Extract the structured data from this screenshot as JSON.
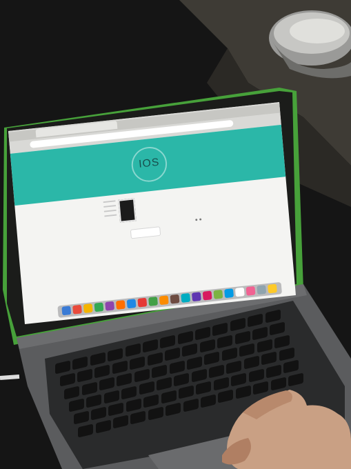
{
  "photo": {
    "subject": "laptop-on-table",
    "colors": {
      "background": "#161616",
      "table": "#3b3933",
      "laptop_bezel": "#1a1b19",
      "case_edge": "#47a13a",
      "chassis": "#5c5d5f",
      "banner": "#2bb7a8",
      "page_bg": "#f4f4f2",
      "skin": "#c9a084"
    }
  },
  "screen": {
    "banner_logo_text": "IOS"
  }
}
